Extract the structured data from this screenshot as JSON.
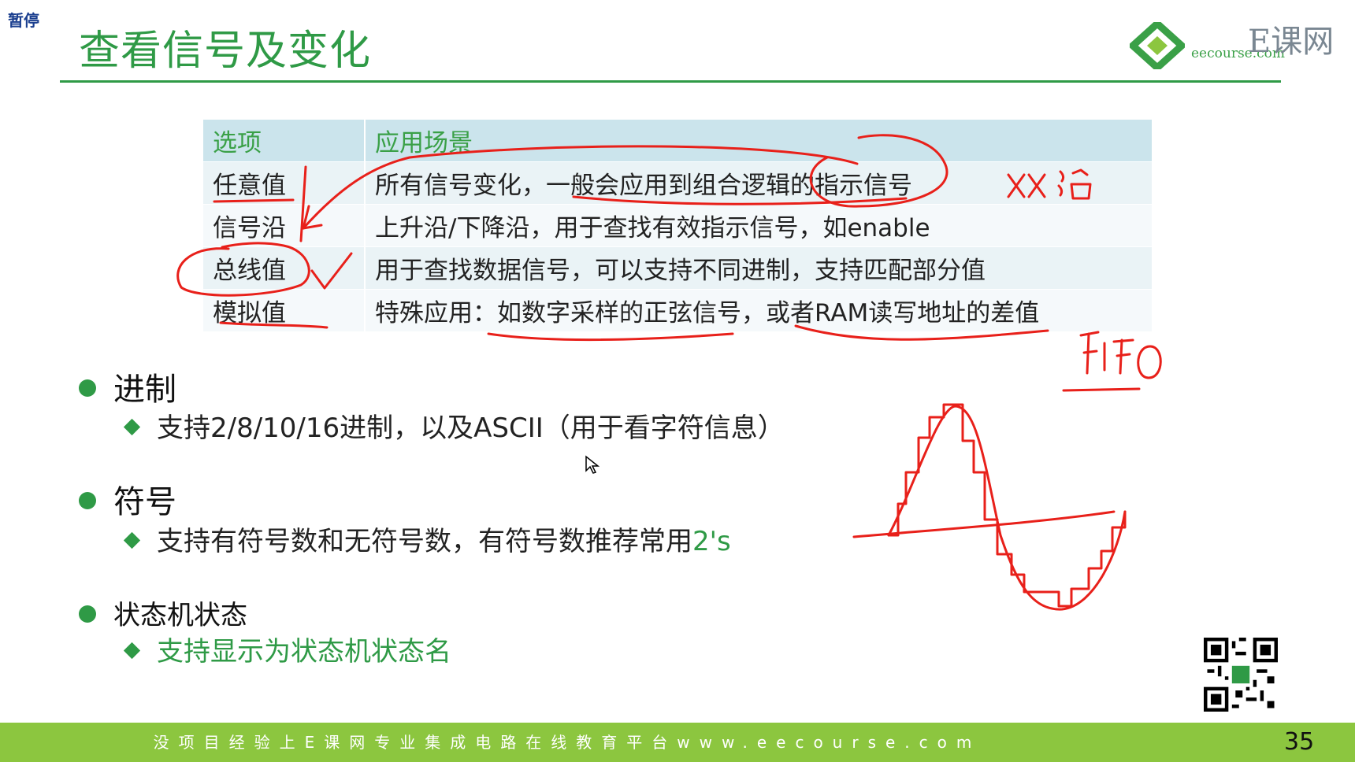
{
  "pause_label": "暂停",
  "title": "查看信号及变化",
  "logo": {
    "cn": "E课网",
    "en": "eecourse.com"
  },
  "table": {
    "headers": [
      "选项",
      "应用场景"
    ],
    "rows": [
      [
        "任意值",
        "所有信号变化，一般会应用到组合逻辑的指示信号"
      ],
      [
        "信号沿",
        "上升沿/下降沿，用于查找有效指示信号，如enable"
      ],
      [
        "总线值",
        "用于查找数据信号，可以支持不同进制，支持匹配部分值"
      ],
      [
        "模拟值",
        "特殊应用：如数字采样的正弦信号，或者RAM读写地址的差值"
      ]
    ]
  },
  "bullets": [
    {
      "title": "进制",
      "sub": "支持2/8/10/16进制，以及ASCII（用于看字符信息）"
    },
    {
      "title": "符号",
      "sub_main": "支持有符号数和无符号数，有符号数推荐常用",
      "sub_accent": "2's"
    },
    {
      "title": "状态机状态",
      "sub": "支持显示为状态机状态名"
    }
  ],
  "annotations": {
    "note1": "双沿",
    "note2": "FIFO"
  },
  "footer": {
    "text": "没项目经验上E课网专业集成电路在线教育平台www.eecourse.com",
    "page": "35"
  },
  "colors": {
    "accent_green": "#2f9a46",
    "footer_green": "#8cc63f",
    "ink_red": "#e8201a",
    "header_blue": "#cbe4ec"
  }
}
